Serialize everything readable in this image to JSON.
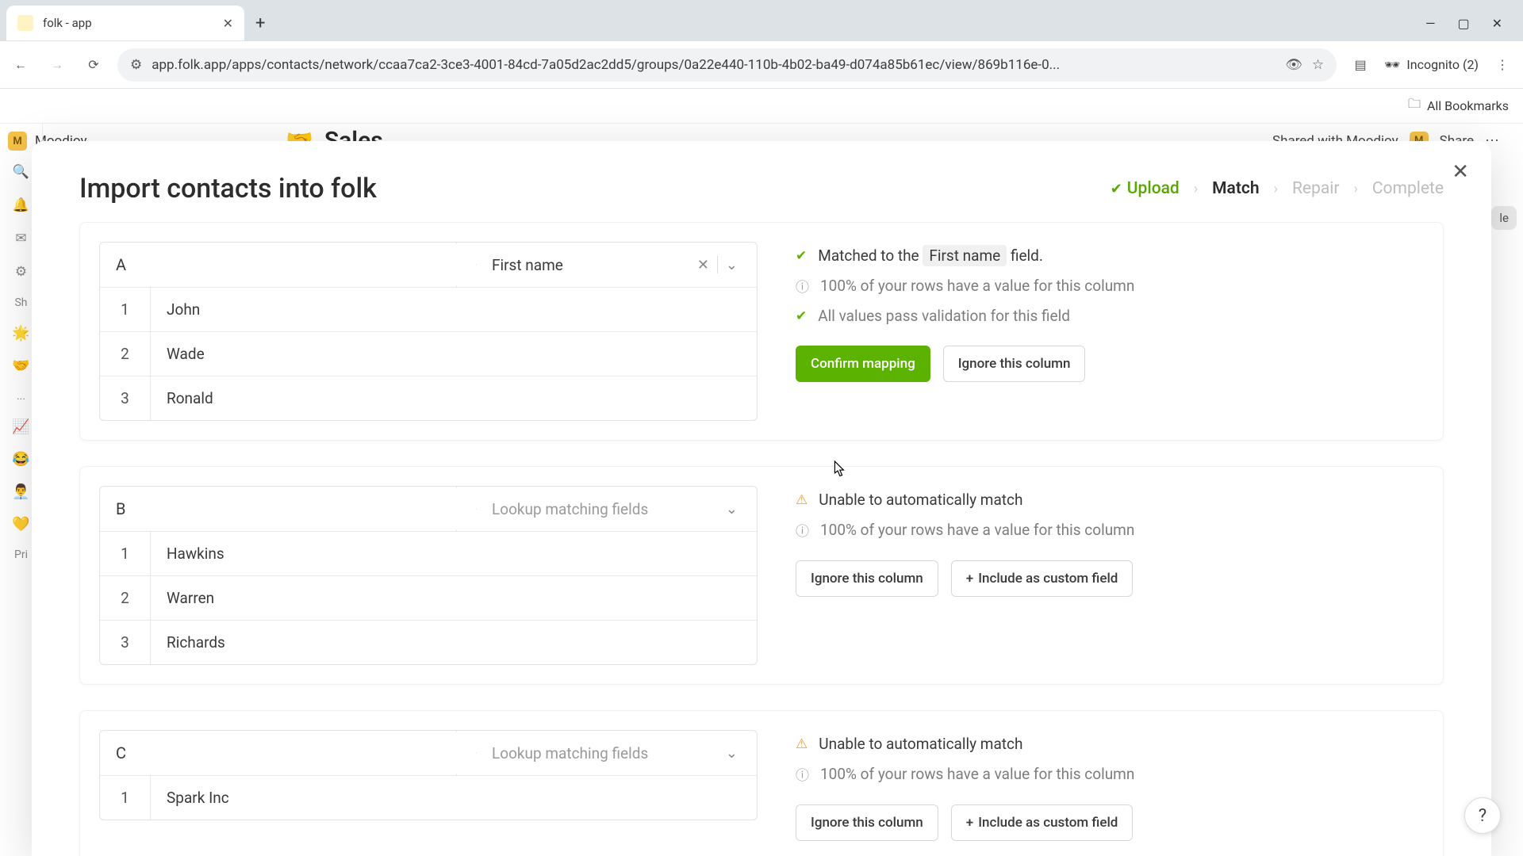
{
  "browser": {
    "tab_title": "folk - app",
    "url": "app.folk.app/apps/contacts/network/ccaa7ca2-3ce3-4001-84cd-7a05d2ac2dd5/groups/0a22e440-110b-4b02-ba49-d074a85b61ec/view/869b116e-0...",
    "incognito_label": "Incognito (2)",
    "all_bookmarks": "All Bookmarks"
  },
  "sidebar": {
    "workspace_name": "Moodjoy",
    "sh_label": "Sh",
    "more_label": "...",
    "priv_label": "Pri"
  },
  "page": {
    "emoji": "🤝",
    "title": "Sales",
    "shared_with": "Shared with Moodjoy",
    "share_label": "Share",
    "right_toggle": "le"
  },
  "modal": {
    "title": "Import contacts into folk",
    "steps": {
      "upload": "Upload",
      "match": "Match",
      "repair": "Repair",
      "complete": "Complete"
    },
    "columns": [
      {
        "letter": "A",
        "field_selected": "First name",
        "placeholder": "",
        "clearable": true,
        "rows": [
          "John",
          "Wade",
          "Ronald"
        ],
        "status": {
          "matched_prefix": "Matched to the",
          "matched_field": "First name",
          "matched_suffix": "field.",
          "coverage": "100% of your rows have a value for this column",
          "validation": "All values pass validation for this field"
        },
        "buttons": {
          "confirm": "Confirm mapping",
          "ignore": "Ignore this column"
        },
        "mode": "matched"
      },
      {
        "letter": "B",
        "field_selected": "",
        "placeholder": "Lookup matching fields",
        "clearable": false,
        "rows": [
          "Hawkins",
          "Warren",
          "Richards"
        ],
        "status": {
          "unmatched": "Unable to automatically match",
          "coverage": "100% of your rows have a value for this column"
        },
        "buttons": {
          "ignore": "Ignore this column",
          "include": "Include as custom field"
        },
        "mode": "unmatched"
      },
      {
        "letter": "C",
        "field_selected": "",
        "placeholder": "Lookup matching fields",
        "clearable": false,
        "rows": [
          "Spark Inc"
        ],
        "status": {
          "unmatched": "Unable to automatically match",
          "coverage": "100% of your rows have a value for this column"
        },
        "buttons": {
          "ignore": "Ignore this column",
          "include": "Include as custom field"
        },
        "mode": "unmatched"
      }
    ]
  },
  "help": {
    "label": "?"
  },
  "colors": {
    "accent_green": "#5cb200",
    "warn_orange": "#e8a13a"
  }
}
